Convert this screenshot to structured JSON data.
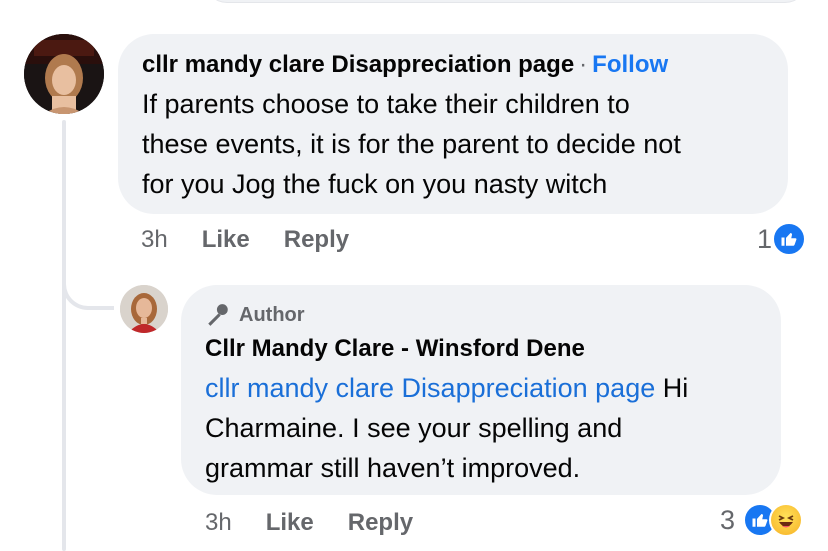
{
  "main_comment": {
    "author": "cllr mandy clare Disappreciation page",
    "separator": "·",
    "follow_label": "Follow",
    "lines": [
      "If parents choose to take their children to",
      "these events, it is for the parent to decide not",
      "for you Jog the fuck on you nasty witch"
    ],
    "time": "3h",
    "like_label": "Like",
    "reply_label": "Reply",
    "reaction_count": "1",
    "reaction_icons": [
      "like-icon"
    ]
  },
  "reply_comment": {
    "badge_label": "Author",
    "badge_icon": "microphone-icon",
    "author": "Cllr Mandy Clare  -  Winsford Dene",
    "mention": "cllr mandy clare Disappreciation page",
    "line1_after_mention": " Hi",
    "lines": [
      "Charmaine.  I see your spelling and",
      "grammar still haven’t improved."
    ],
    "time": "3h",
    "like_label": "Like",
    "reply_label": "Reply",
    "reaction_count": "3",
    "reaction_icons": [
      "like-icon",
      "haha-icon"
    ]
  },
  "colors": {
    "link_blue": "#1877f2",
    "bubble_gray": "#f0f2f5",
    "meta_gray": "#65676b"
  }
}
